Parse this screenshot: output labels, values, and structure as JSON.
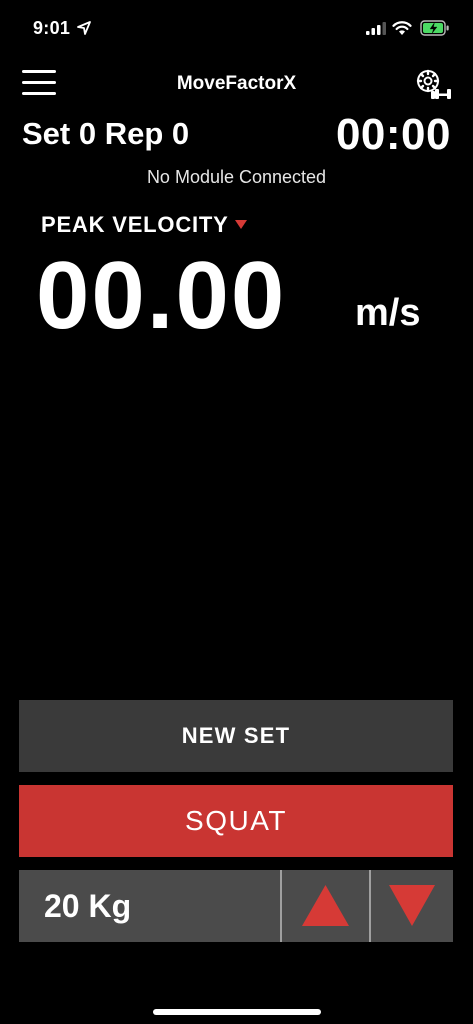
{
  "status_bar": {
    "time": "9:01",
    "icons": [
      "location-arrow-icon",
      "cellular-signal-icon",
      "wifi-icon",
      "battery-charging-icon"
    ]
  },
  "header": {
    "title": "MoveFactorX",
    "left_icon": "hamburger-menu-icon",
    "right_icon": "module-barbell-settings-icon"
  },
  "session": {
    "set_rep": "Set 0 Rep 0",
    "timer": "00:00",
    "module_status": "No Module Connected"
  },
  "metric": {
    "label": "PEAK VELOCITY",
    "value": "00.00",
    "unit": "m/s"
  },
  "actions": {
    "new_set_label": "NEW SET",
    "exercise_label": "SQUAT",
    "weight": "20 Kg"
  },
  "colors": {
    "accent_red": "#c93532",
    "new_set_bg": "#3a3a3a",
    "weight_bg": "#4b4b4b",
    "background": "#000000"
  }
}
